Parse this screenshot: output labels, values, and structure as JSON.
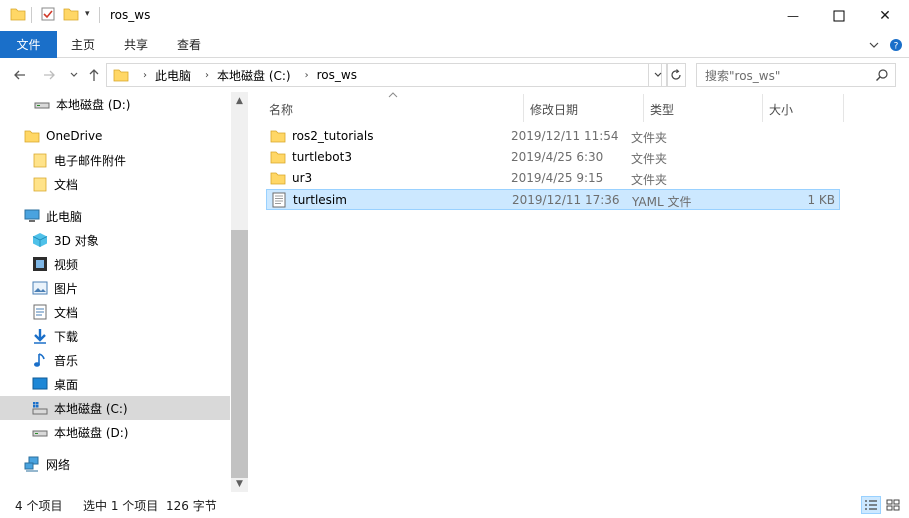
{
  "window": {
    "title": "ros_ws",
    "minimize_glyph": "—",
    "close_glyph": "✕"
  },
  "ribbon": {
    "tabs": [
      "文件",
      "主页",
      "共享",
      "查看"
    ]
  },
  "address": {
    "crumbs": [
      "此电脑",
      "本地磁盘 (C:)",
      "ros_ws"
    ]
  },
  "search": {
    "placeholder": "搜索\"ros_ws\""
  },
  "nav": {
    "items": [
      {
        "label": "本地磁盘 (D:)",
        "icon": "drive-icon"
      },
      {
        "label": "OneDrive",
        "icon": "onedrive-folder-icon"
      },
      {
        "label": "电子邮件附件",
        "icon": "folder-icon"
      },
      {
        "label": "文档",
        "icon": "folder-icon"
      },
      {
        "label": "此电脑",
        "icon": "computer-icon"
      },
      {
        "label": "3D 对象",
        "icon": "3d-objects-icon"
      },
      {
        "label": "视频",
        "icon": "video-icon"
      },
      {
        "label": "图片",
        "icon": "pictures-icon"
      },
      {
        "label": "文档",
        "icon": "documents-icon"
      },
      {
        "label": "下载",
        "icon": "download-icon"
      },
      {
        "label": "音乐",
        "icon": "music-icon"
      },
      {
        "label": "桌面",
        "icon": "desktop-icon"
      },
      {
        "label": "本地磁盘 (C:)",
        "icon": "system-drive-icon"
      },
      {
        "label": "本地磁盘 (D:)",
        "icon": "drive-icon"
      },
      {
        "label": "网络",
        "icon": "network-icon"
      }
    ]
  },
  "columns": {
    "name": "名称",
    "date": "修改日期",
    "type": "类型",
    "size": "大小"
  },
  "files": [
    {
      "name": "ros2_tutorials",
      "date": "2019/12/11 11:54",
      "type": "文件夹",
      "size": ""
    },
    {
      "name": "turtlebot3",
      "date": "2019/4/25 6:30",
      "type": "文件夹",
      "size": ""
    },
    {
      "name": "ur3",
      "date": "2019/4/25 9:15",
      "type": "文件夹",
      "size": ""
    },
    {
      "name": "turtlesim",
      "date": "2019/12/11 17:36",
      "type": "YAML 文件",
      "size": "1 KB"
    }
  ],
  "status": {
    "item_count": "4 个项目",
    "selected": "选中 1 个项目",
    "selected_size": "126 字节"
  },
  "colors": {
    "accent": "#1a6fc9",
    "selection": "#cce8ff",
    "folder": "#ffd766"
  }
}
